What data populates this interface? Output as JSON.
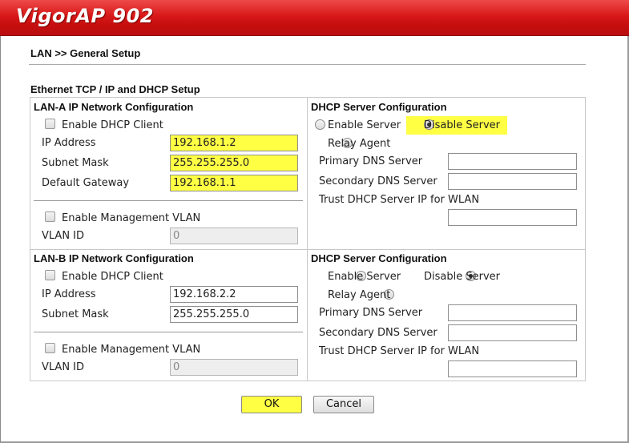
{
  "app": {
    "title": "VigorAP 902"
  },
  "breadcrumb": "LAN >> General Setup",
  "section_title": "Ethernet TCP / IP and DHCP Setup",
  "lan_a": {
    "header": "LAN-A IP Network Configuration",
    "enable_dhcp_client": "Enable DHCP Client",
    "ip_label": "IP Address",
    "ip_value": "192.168.1.2",
    "mask_label": "Subnet Mask",
    "mask_value": "255.255.255.0",
    "gateway_label": "Default Gateway",
    "gateway_value": "192.168.1.1",
    "enable_mgmt_vlan": "Enable Management VLAN",
    "vlan_label": "VLAN ID",
    "vlan_value": "0"
  },
  "dhcp_a": {
    "header": "DHCP Server Configuration",
    "enable_server": "Enable Server",
    "disable_server": "Disable Server",
    "relay_agent": "Relay Agent",
    "primary_dns": "Primary DNS Server",
    "secondary_dns": "Secondary DNS Server",
    "trust_dhcp": "Trust DHCP Server IP for WLAN",
    "primary_value": "",
    "secondary_value": "",
    "trust_value": ""
  },
  "lan_b": {
    "header": "LAN-B IP Network Configuration",
    "enable_dhcp_client": "Enable DHCP Client",
    "ip_label": "IP Address",
    "ip_value": "192.168.2.2",
    "mask_label": "Subnet Mask",
    "mask_value": "255.255.255.0",
    "enable_mgmt_vlan": "Enable Management VLAN",
    "vlan_label": "VLAN ID",
    "vlan_value": "0"
  },
  "dhcp_b": {
    "header": "DHCP Server Configuration",
    "enable_server": "Enable Server",
    "disable_server": "Disable Server",
    "relay_agent": "Relay Agent",
    "primary_dns": "Primary DNS Server",
    "secondary_dns": "Secondary DNS Server",
    "trust_dhcp": "Trust DHCP Server IP for WLAN",
    "primary_value": "",
    "secondary_value": "",
    "trust_value": ""
  },
  "buttons": {
    "ok": "OK",
    "cancel": "Cancel"
  },
  "colors": {
    "header_red": "#d81818",
    "highlight_yellow": "#ffff44"
  }
}
